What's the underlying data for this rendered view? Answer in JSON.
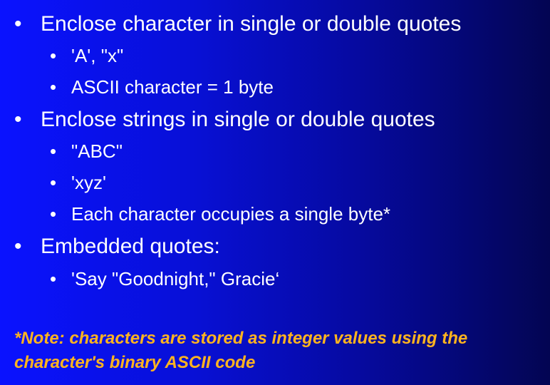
{
  "bullets": {
    "char_quotes": "Enclose character in single or double quotes",
    "char_example": "'A', \"x\"",
    "char_size": "ASCII character = 1 byte",
    "string_quotes": "Enclose strings in single or double quotes",
    "string_example_1": "\"ABC\"",
    "string_example_2": "'xyz'",
    "string_size": "Each character occupies a single byte*",
    "embedded_quotes": "Embedded quotes:",
    "embedded_example": "'Say \"Goodnight,\" Gracie‘"
  },
  "bullet_symbol": "•",
  "note": "*Note: characters are stored as integer values using the character's binary ASCII code",
  "colors": {
    "background_left": "#0a12ff",
    "background_right": "#030552",
    "text": "#ffffff",
    "note": "#ffb41f"
  }
}
